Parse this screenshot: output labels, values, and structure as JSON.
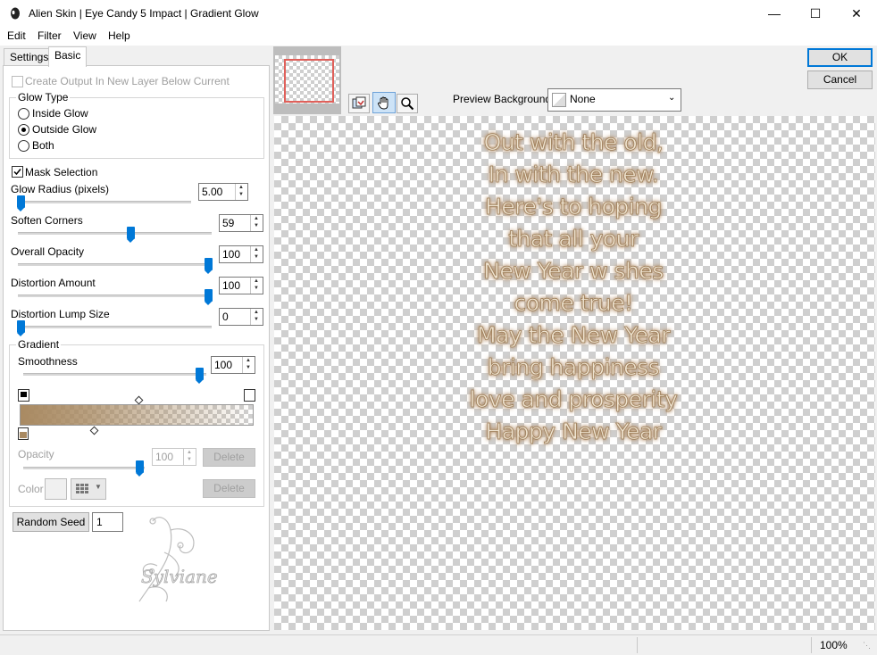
{
  "window": {
    "title": "Alien Skin | Eye Candy 5 Impact | Gradient Glow"
  },
  "menu": {
    "items": [
      "Edit",
      "Filter",
      "View",
      "Help"
    ]
  },
  "tabs": [
    "Settings",
    "Basic"
  ],
  "basic": {
    "create_output_label": "Create Output In New Layer Below Current",
    "glow_type_title": "Glow Type",
    "glow_types": [
      "Inside Glow",
      "Outside Glow",
      "Both"
    ],
    "glow_type_selected": "Outside Glow",
    "mask_selection_label": "Mask Selection",
    "mask_selection_checked": true,
    "glow_radius_label": "Glow Radius (pixels)",
    "glow_radius_value": "5.00",
    "soften_corners_label": "Soften Corners",
    "soften_corners_value": "59",
    "overall_opacity_label": "Overall Opacity",
    "overall_opacity_value": "100",
    "distortion_amount_label": "Distortion Amount",
    "distortion_amount_value": "100",
    "distortion_lump_label": "Distortion Lump Size",
    "distortion_lump_value": "0",
    "gradient_title": "Gradient",
    "smoothness_label": "Smoothness",
    "smoothness_value": "100",
    "gradient_color": "#a98a62",
    "opacity_label": "Opacity",
    "opacity_value": "100",
    "color_label": "Color",
    "delete_label": "Delete",
    "random_seed_label": "Random Seed",
    "random_seed_value": "1",
    "watermark": "Sylviane"
  },
  "preview": {
    "background_label": "Preview Background:",
    "background_value": "None",
    "text_lines": [
      "Out with the old,",
      "In with the new.",
      "Here's to hoping",
      "that all your",
      "New Year w shes",
      "come true!",
      "May the New Year",
      "bring happiness",
      "love and prosperity",
      "Happy New Year"
    ]
  },
  "buttons": {
    "ok": "OK",
    "cancel": "Cancel"
  },
  "status": {
    "zoom": "100%"
  }
}
